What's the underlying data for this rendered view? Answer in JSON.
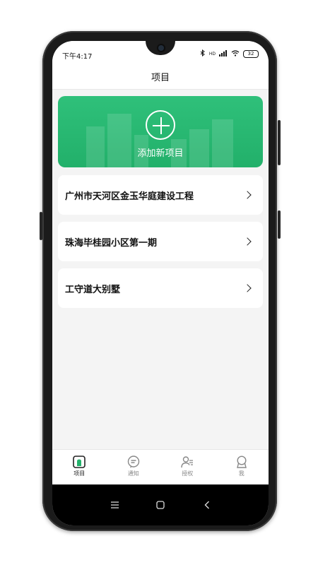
{
  "statusbar": {
    "time": "下午4:17",
    "signal_text": "HD",
    "battery": "32"
  },
  "header": {
    "title": "项目"
  },
  "add_card": {
    "label": "添加新项目",
    "color": "#24b26c"
  },
  "projects": [
    {
      "name": "广州市天河区金玉华庭建设工程"
    },
    {
      "name": "珠海毕桂园小区第一期"
    },
    {
      "name": "工守道大别墅"
    }
  ],
  "tabs": [
    {
      "label": "项目",
      "icon": "project-icon",
      "active": true
    },
    {
      "label": "通知",
      "icon": "message-icon",
      "active": false
    },
    {
      "label": "授权",
      "icon": "user-list-icon",
      "active": false
    },
    {
      "label": "我",
      "icon": "profile-icon",
      "active": false
    }
  ],
  "nav": [
    "menu-icon",
    "home-icon",
    "back-icon"
  ],
  "colors": {
    "accent": "#24b26c",
    "background": "#f4f4f4"
  }
}
